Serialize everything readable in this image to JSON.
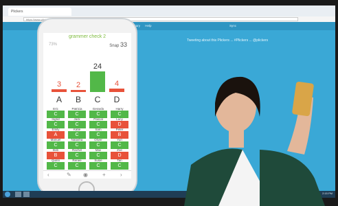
{
  "browser": {
    "tab": "Plickers",
    "url": "https://www.plickers.com/..."
  },
  "app": {
    "logo": "plickers",
    "nav": "Classes Reports Library Help",
    "nav_right": "Sync",
    "tweet": "Tweeting about this Plickers ... #Plickers ... @plickers"
  },
  "phone": {
    "title": "grammer check 2",
    "percent": "73%",
    "snap_label": "Snap",
    "snap_count": "33",
    "answers": [
      {
        "letter": "A",
        "count": "3",
        "color": "#e8523a"
      },
      {
        "letter": "B",
        "count": "2",
        "color": "#e8523a"
      },
      {
        "letter": "C",
        "count": "24",
        "color": "#52b848"
      },
      {
        "letter": "D",
        "count": "4",
        "color": "#e8523a"
      }
    ],
    "students": [
      [
        {
          "name": "Eric",
          "ans": "C",
          "ok": true
        },
        {
          "name": "Patricia",
          "ans": "C",
          "ok": true
        },
        {
          "name": "Gerardo",
          "ans": "C",
          "ok": true
        },
        {
          "name": "Harry",
          "ans": "C",
          "ok": true
        }
      ],
      [
        {
          "name": "Ingrid",
          "ans": "C",
          "ok": true
        },
        {
          "name": "Jack",
          "ans": "C",
          "ok": true
        },
        {
          "name": "Pascal",
          "ans": "C",
          "ok": true
        },
        {
          "name": "Lucy",
          "ans": "D",
          "ok": false
        }
      ],
      [
        {
          "name": "Emily",
          "ans": "A",
          "ok": false
        },
        {
          "name": "Katie",
          "ans": "C",
          "ok": true
        },
        {
          "name": "Sam",
          "ans": "C",
          "ok": true
        },
        {
          "name": "Peter",
          "ans": "B",
          "ok": false
        }
      ],
      [
        {
          "name": "Manuel",
          "ans": "C",
          "ok": true
        },
        {
          "name": "Natasha",
          "ans": "C",
          "ok": true
        },
        {
          "name": "Oliver",
          "ans": "C",
          "ok": true
        },
        {
          "name": "Yuri",
          "ans": "C",
          "ok": true
        }
      ],
      [
        {
          "name": "Bob",
          "ans": "B",
          "ok": false
        },
        {
          "name": "Rachel",
          "ans": "C",
          "ok": true
        },
        {
          "name": "Max",
          "ans": "C",
          "ok": true
        },
        {
          "name": "Zoe",
          "ans": "D",
          "ok": false
        }
      ],
      [
        {
          "name": "Quinn",
          "ans": "C",
          "ok": true
        },
        {
          "name": "Renee",
          "ans": "C",
          "ok": true
        },
        {
          "name": "Susie",
          "ans": "C",
          "ok": true
        },
        {
          "name": "Tan",
          "ans": "C",
          "ok": true
        }
      ]
    ]
  },
  "taskbar": {
    "clock": "2:15 PM"
  }
}
